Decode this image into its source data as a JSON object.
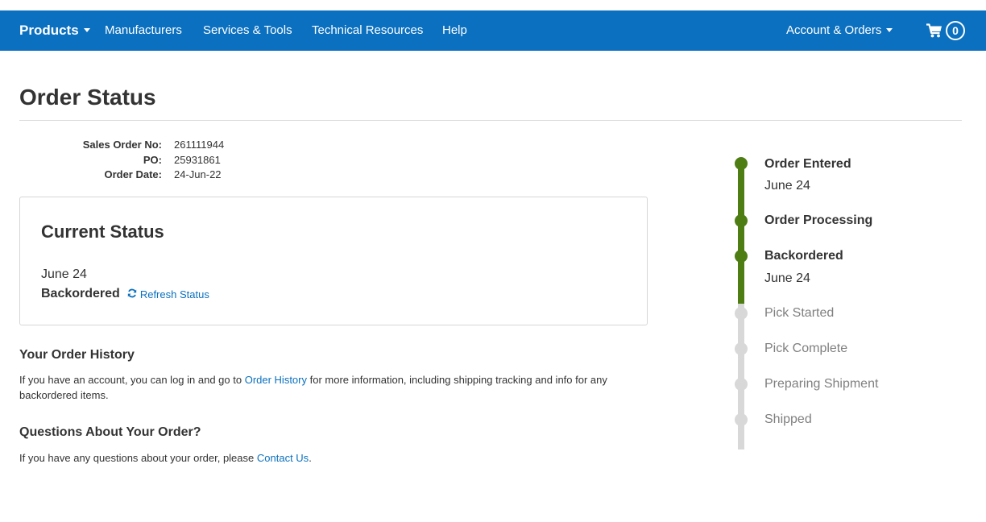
{
  "nav": {
    "brand": "Products",
    "links": [
      "Manufacturers",
      "Services & Tools",
      "Technical Resources",
      "Help"
    ],
    "account": "Account & Orders",
    "cart_count": "0",
    "cart_icon": "shopping-cart-icon",
    "bar_color": "#0b70bf"
  },
  "page": {
    "title": "Order Status"
  },
  "order": {
    "sales_order_label": "Sales Order No:",
    "sales_order_value": "261111944",
    "po_label": "PO:",
    "po_value": "25931861",
    "date_label": "Order Date:",
    "date_value": "24-Jun-22"
  },
  "current_status": {
    "title": "Current Status",
    "date": "June 24",
    "status": "Backordered",
    "refresh_label": "Refresh Status",
    "refresh_icon": "refresh-icon"
  },
  "history": {
    "heading": "Your Order History",
    "text_before": "If you have an account, you can log in and go to ",
    "link": "Order History",
    "text_after": " for more information, including shipping tracking and info for any backordered items."
  },
  "questions": {
    "heading": "Questions About Your Order?",
    "text_before": "If you have any questions about your order, please ",
    "link": "Contact Us",
    "text_after": "."
  },
  "timeline": {
    "done_color": "#4e7d14",
    "todo_color": "#d8d8d8",
    "steps": [
      {
        "label": "Order Entered",
        "date": "June 24",
        "complete": true
      },
      {
        "label": "Order Processing",
        "date": "",
        "complete": true
      },
      {
        "label": "Backordered",
        "date": "June 24",
        "complete": true
      },
      {
        "label": "Pick Started",
        "date": "",
        "complete": false
      },
      {
        "label": "Pick Complete",
        "date": "",
        "complete": false
      },
      {
        "label": "Preparing Shipment",
        "date": "",
        "complete": false
      },
      {
        "label": "Shipped",
        "date": "",
        "complete": false
      }
    ]
  }
}
